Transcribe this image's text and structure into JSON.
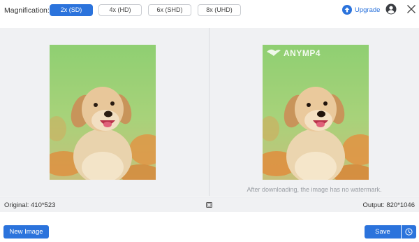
{
  "toolbar": {
    "magnification_label": "Magnification:",
    "options": [
      {
        "label": "2x (SD)",
        "selected": true
      },
      {
        "label": "4x (HD)",
        "selected": false
      },
      {
        "label": "6x (SHD)",
        "selected": false
      },
      {
        "label": "8x (UHD)",
        "selected": false
      }
    ],
    "upgrade_label": "Upgrade",
    "icons": [
      "upgrade-arrow-icon",
      "user-account-icon",
      "close-icon"
    ]
  },
  "preview": {
    "watermark_text": "ANYMP4",
    "note": "After downloading, the image has no watermark."
  },
  "info": {
    "original": "Original: 410*523",
    "output": "Output: 820*1046"
  },
  "footer": {
    "new_image_label": "New Image",
    "save_label": "Save"
  },
  "colors": {
    "accent": "#2b73dc",
    "panel_bg": "#f0f1f3"
  }
}
